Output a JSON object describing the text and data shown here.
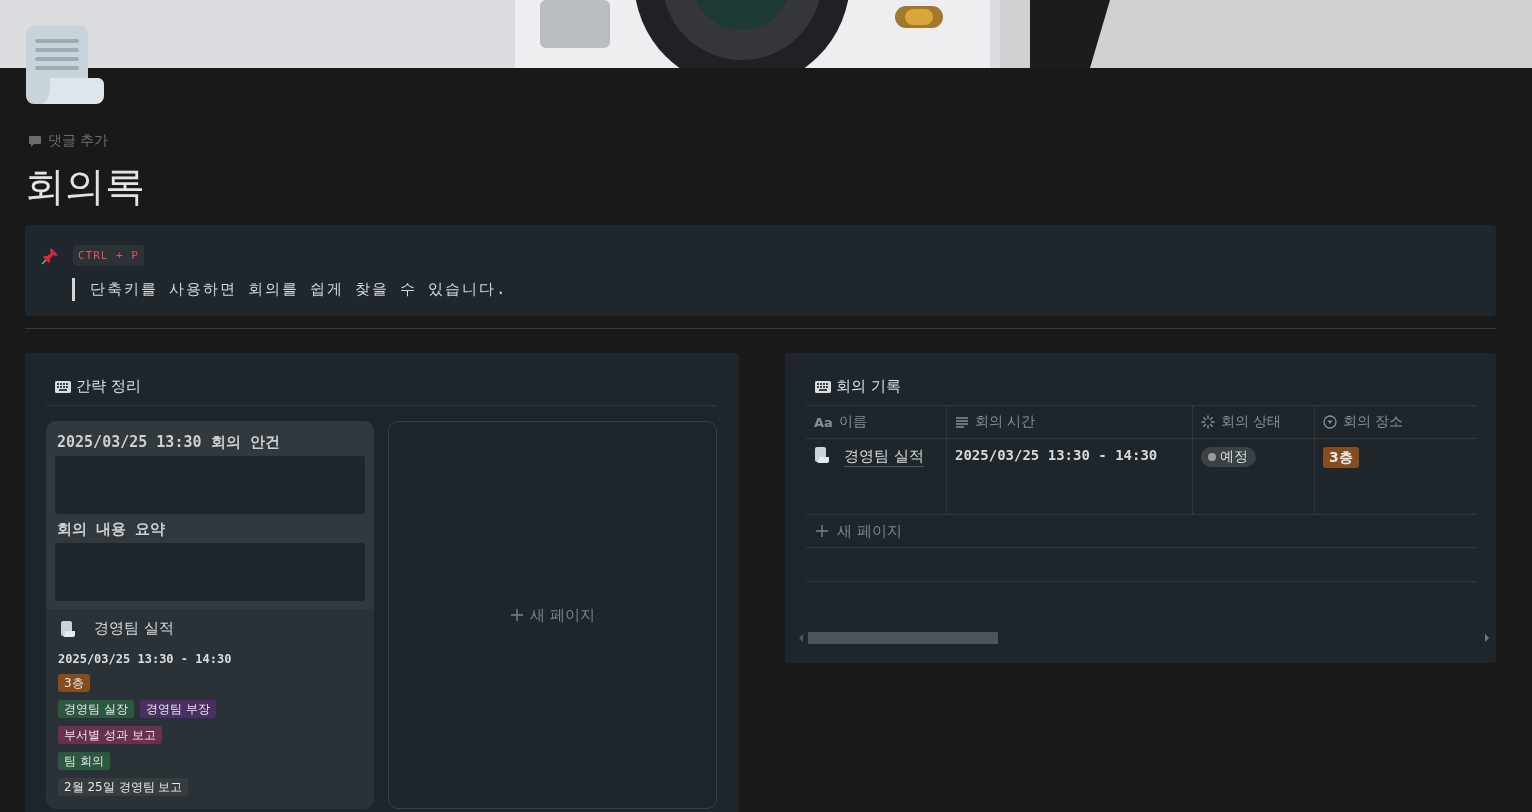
{
  "comment_action": "댓글 추가",
  "title": "회의록",
  "callout": {
    "shortcut": "CTRL + P",
    "quote": "단축키를 사용하면 회의를 쉽게 찾을 수 있습니다."
  },
  "gallery": {
    "title": "간략 정리",
    "cards": [
      {
        "sections": [
          "2025/03/25 13:30 회의 안건",
          "회의 내용 요약"
        ],
        "name": "경영팀 실적",
        "time": "2025/03/25 13:30 - 14:30",
        "tag_rows": [
          [
            {
              "text": "3층",
              "color": "#854c1d"
            }
          ],
          [
            {
              "text": "경영팀 실장",
              "color": "#2b593f"
            },
            {
              "text": "경영팀 부장",
              "color": "#492f64"
            }
          ],
          [
            {
              "text": "부서별 성과 보고",
              "color": "#69314c"
            }
          ],
          [
            {
              "text": "팀 회의",
              "color": "#2b593f"
            }
          ],
          [
            {
              "text": "2월 25일 경영팀 보고",
              "color": "#373c3f"
            }
          ]
        ]
      }
    ],
    "new_page": "새 페이지"
  },
  "table": {
    "title": "회의 기록",
    "columns": [
      {
        "label": "이름",
        "kind": "title",
        "icon": "Aa"
      },
      {
        "label": "회의 시간",
        "kind": "text"
      },
      {
        "label": "회의 상태",
        "kind": "status"
      },
      {
        "label": "회의 장소",
        "kind": "select"
      }
    ],
    "rows": [
      {
        "name": "경영팀 실적",
        "time": "2025/03/25 13:30 - 14:30",
        "status": {
          "text": "예정",
          "color": "#9b9b9b"
        },
        "place": {
          "text": "3층",
          "color": "#854c1d"
        }
      }
    ],
    "new_page": "새 페이지"
  }
}
